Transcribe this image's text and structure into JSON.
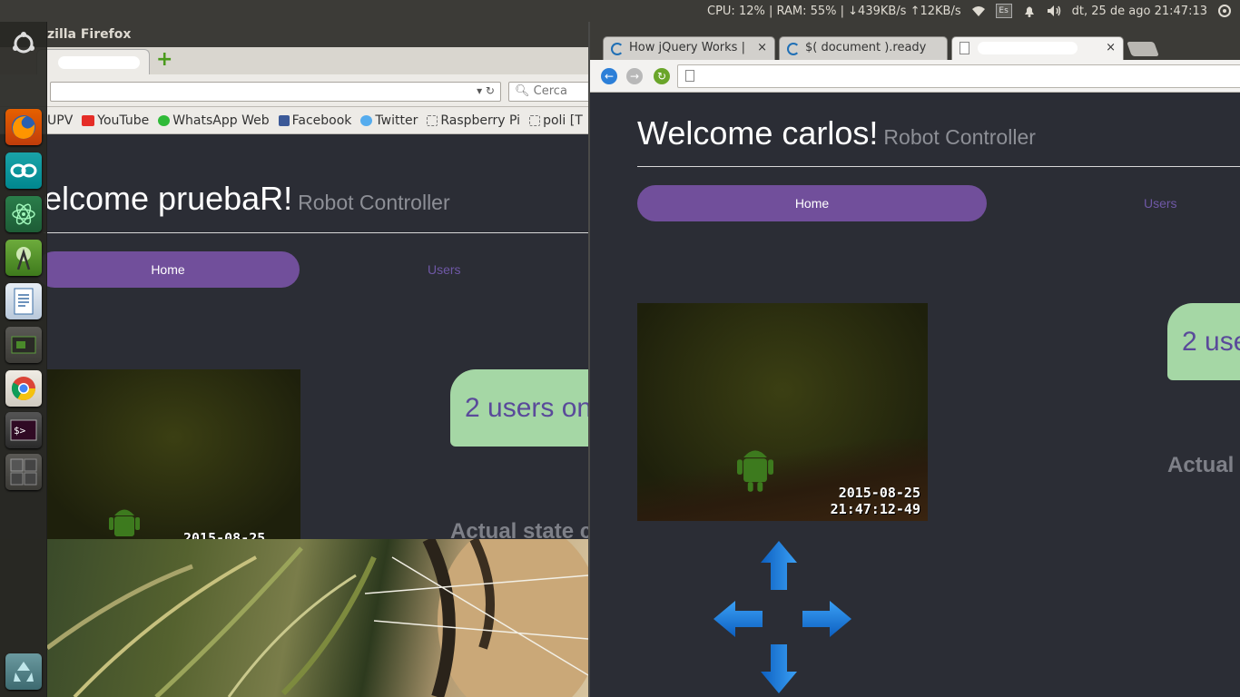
{
  "panel": {
    "stats": "CPU: 12% | RAM: 55% | ↓439KB/s ↑12KB/s",
    "keyboard": "Es",
    "datetime": "dt, 25 de ago 21:47:13"
  },
  "launcher": {
    "items": [
      "ubuntu-dash",
      "firefox",
      "arduino",
      "atom",
      "android-studio",
      "libreoffice-writer",
      "system-monitor",
      "chrome",
      "terminal",
      "workspace-switcher",
      "trash"
    ]
  },
  "firefox": {
    "title": "zilla Firefox",
    "new_tab": "+",
    "search_placeholder": "Cerca",
    "bookmarks": [
      "UPV",
      "YouTube",
      "WhatsApp Web",
      "Facebook",
      "Twitter",
      "Raspberry Pi",
      "poli [T"
    ],
    "page": {
      "welcome": "elcome pruebaR!",
      "subtitle": "Robot Controller",
      "nav_home": "Home",
      "nav_users": "Users",
      "bubble": "2 users on",
      "state": "Actual state c",
      "timestamp": "2015-08-25"
    }
  },
  "chrome": {
    "tabs": [
      {
        "label": "How jQuery Works |"
      },
      {
        "label": "$( document ).ready"
      },
      {
        "label": ""
      }
    ],
    "close": "×",
    "page": {
      "welcome": "Welcome carlos!",
      "subtitle": "Robot Controller",
      "nav_home": "Home",
      "nav_users": "Users",
      "bubble": "2 use",
      "state": "Actual s",
      "timestamp_date": "2015-08-25",
      "timestamp_time": "21:47:12-49"
    }
  },
  "colors": {
    "page_bg": "#2b2d35",
    "accent_purple": "#714f9b",
    "bubble_green": "#a5d7a5",
    "arrow_blue": "#1a7fe0"
  }
}
